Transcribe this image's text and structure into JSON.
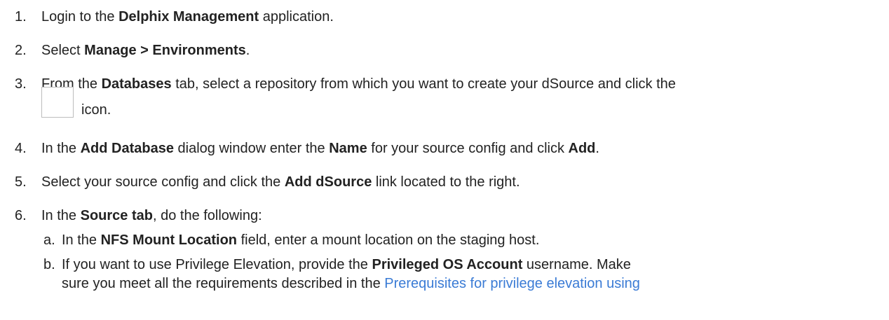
{
  "steps": [
    {
      "num": "1.",
      "pre": "Login to the ",
      "bold1": "Delphix Management",
      "post": " application."
    },
    {
      "num": "2.",
      "pre": "Select ",
      "bold1": "Manage > Environments",
      "post": "."
    },
    {
      "num": "3.",
      "pre": "From the ",
      "bold1": "Databases",
      "post": " tab, select a repository from which you want to create your dSource and click the",
      "icon_label": "icon."
    },
    {
      "num": "4.",
      "pre": "In the ",
      "bold1": "Add Database",
      "mid": " dialog window enter the ",
      "bold2": "Name",
      "mid2": " for your source config and click ",
      "bold3": "Add",
      "post": "."
    },
    {
      "num": "5.",
      "pre": "Select your source config and click the ",
      "bold1": "Add dSource",
      "post": " link located to the right."
    },
    {
      "num": "6.",
      "pre": "In the ",
      "bold1": "Source tab",
      "post": ", do the following:"
    }
  ],
  "substeps": [
    {
      "num": "a.",
      "pre": "In the ",
      "bold1": "NFS Mount Location",
      "post": " field, enter a mount location on the staging host."
    },
    {
      "num": "b.",
      "pre": "If you want to use Privilege Elevation, provide the ",
      "bold1": "Privileged OS Account",
      "post": " username. Make",
      "line2_pre": "sure you meet all the requirements described in the ",
      "line2_link": "Prerequisites for privilege elevation using"
    }
  ]
}
